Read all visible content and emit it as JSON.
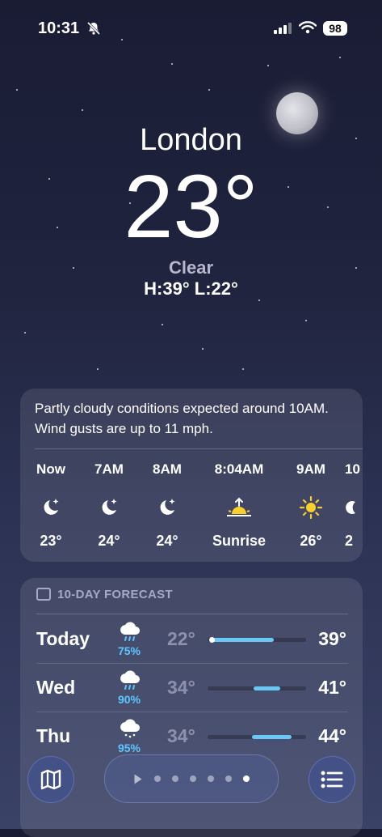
{
  "status": {
    "time": "10:31",
    "battery": "98"
  },
  "header": {
    "city": "London",
    "temp": "23°",
    "condition": "Clear",
    "hilo": "H:39°  L:22°"
  },
  "hourly": {
    "summary": "Partly cloudy conditions expected around 10AM. Wind gusts are up to 11 mph.",
    "items": [
      {
        "time": "Now",
        "icon": "moon-stars-icon",
        "value": "23°"
      },
      {
        "time": "7AM",
        "icon": "moon-stars-icon",
        "value": "24°"
      },
      {
        "time": "8AM",
        "icon": "moon-stars-icon",
        "value": "24°"
      },
      {
        "time": "8:04AM",
        "icon": "sunrise-icon",
        "value": "Sunrise"
      },
      {
        "time": "9AM",
        "icon": "sun-icon",
        "value": "26°"
      },
      {
        "time": "10",
        "icon": "moon-icon",
        "value": "2"
      }
    ]
  },
  "forecast": {
    "heading": "10-DAY FORECAST",
    "days": [
      {
        "day": "Today",
        "precip": "75%",
        "low": "22°",
        "high": "39°",
        "bar_start": 0.05,
        "bar_end": 0.67,
        "current_dot": true
      },
      {
        "day": "Wed",
        "precip": "90%",
        "low": "34°",
        "high": "41°",
        "bar_start": 0.47,
        "bar_end": 0.74
      },
      {
        "day": "Thu",
        "precip": "95%",
        "low": "34°",
        "high": "44°",
        "bar_start": 0.45,
        "bar_end": 0.85
      }
    ]
  },
  "colors": {
    "precip": "#5cc8ff",
    "bar_fill": "#6ac8f5"
  },
  "toolbar": {
    "map_icon": "map-icon",
    "list_icon": "list-icon",
    "pages": 7,
    "active_page": 7
  }
}
